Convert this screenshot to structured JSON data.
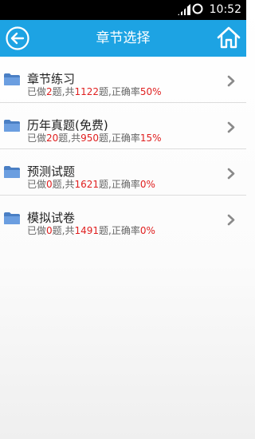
{
  "status_bar": {
    "time": "10:52"
  },
  "header": {
    "title": "章节选择"
  },
  "list": {
    "labels": {
      "done_prefix": "已做",
      "done_suffix": "题,共",
      "total_suffix": "题,正确率"
    },
    "items": [
      {
        "name": "章节练习",
        "done": "2",
        "total": "1122",
        "accuracy": "50%"
      },
      {
        "name": "历年真题(免费)",
        "done": "20",
        "total": "950",
        "accuracy": "15%"
      },
      {
        "name": "预测试题",
        "done": "0",
        "total": "1621",
        "accuracy": "0%"
      },
      {
        "name": "模拟试卷",
        "done": "0",
        "total": "1491",
        "accuracy": "0%"
      }
    ]
  },
  "colors": {
    "header_bg": "#1da3e3",
    "highlight": "#e02020",
    "folder": "#5b8fd0"
  },
  "icons": [
    "signal-icon",
    "sync-icon",
    "back-arrow-icon",
    "home-icon",
    "folder-icon",
    "chevron-right-icon"
  ]
}
